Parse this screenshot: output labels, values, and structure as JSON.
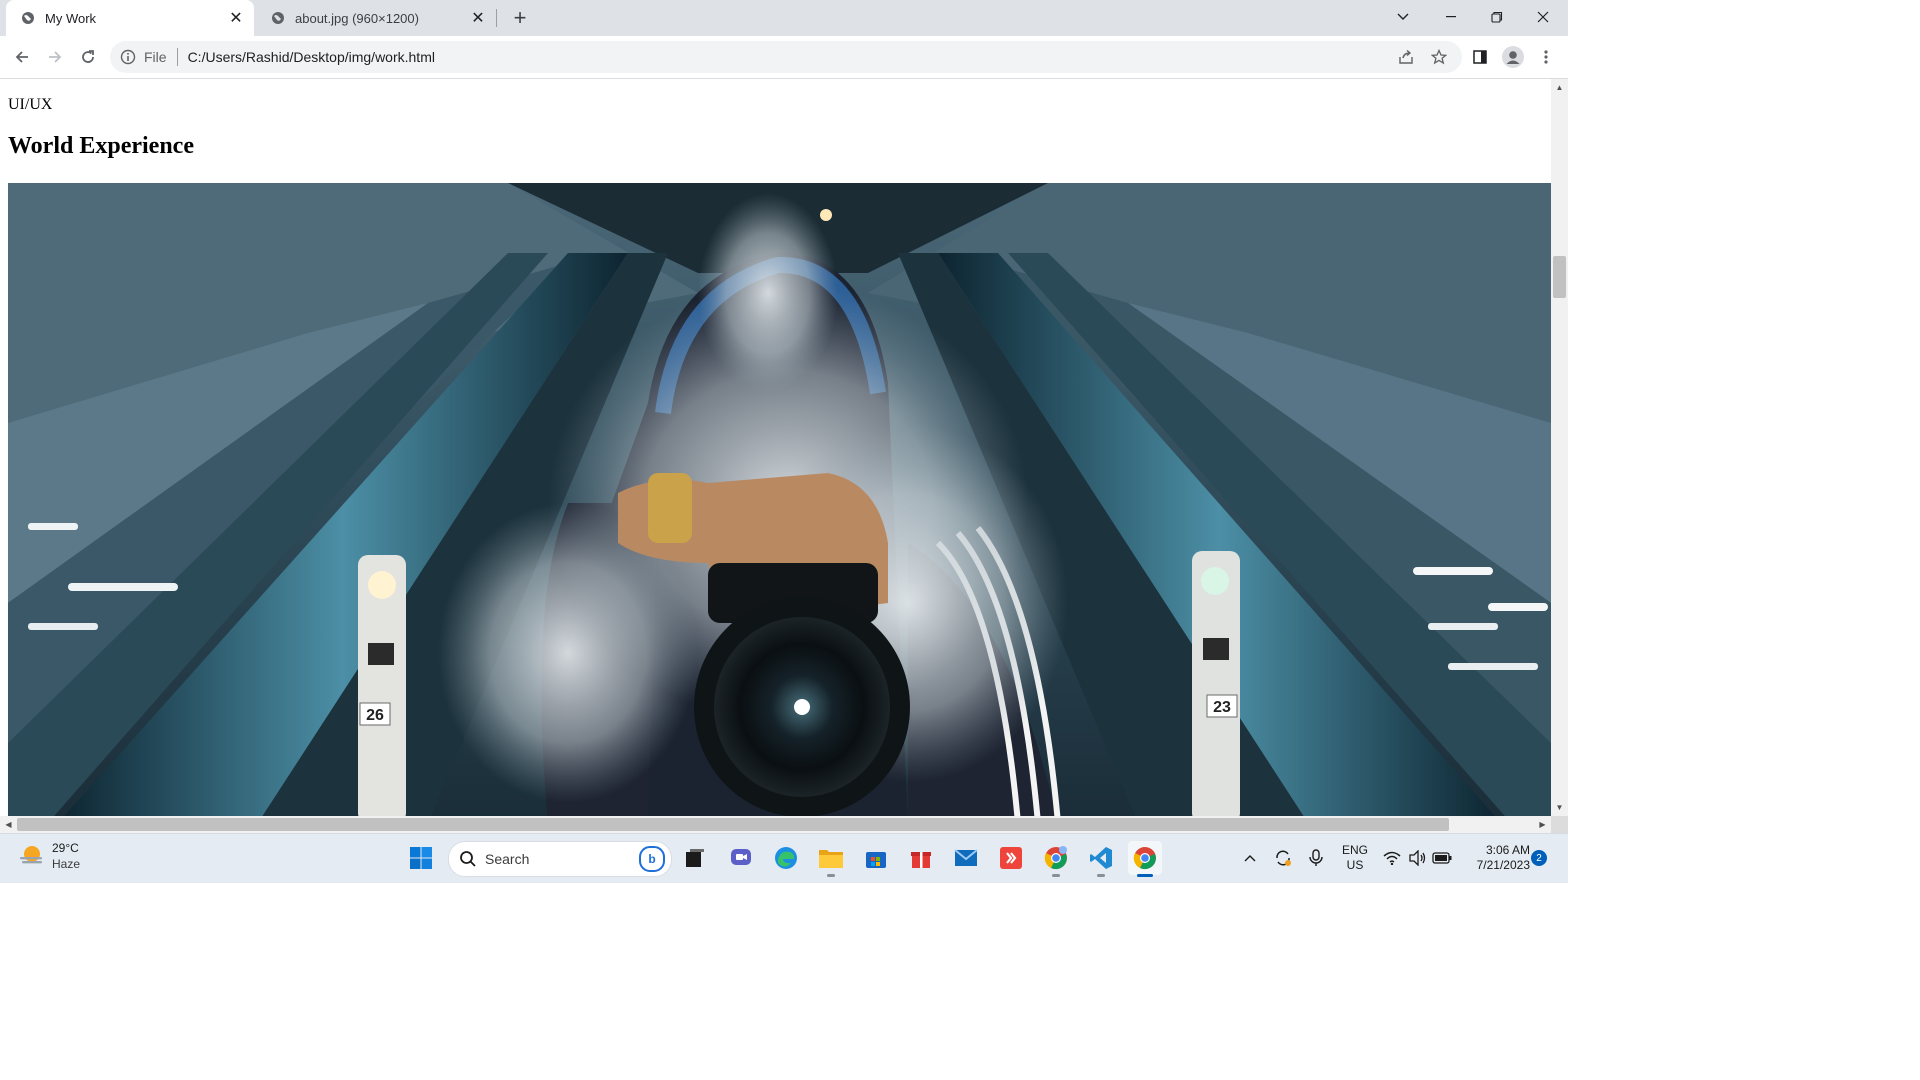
{
  "browser": {
    "tabs": [
      {
        "title": "My Work",
        "active": true
      },
      {
        "title": "about.jpg (960×1200)",
        "active": false
      }
    ],
    "address": {
      "scheme_label": "File",
      "url": "C:/Users/Rashid/Desktop/img/work.html"
    }
  },
  "page": {
    "subtitle": "UI/UX",
    "heading": "World Experience",
    "image_description_name": "photographer-with-camera-on-escalator",
    "escalator_numbers": {
      "left": "26",
      "right": "23"
    },
    "vertical_scroll_fraction": 0.27
  },
  "taskbar": {
    "weather": {
      "temp": "29°C",
      "condition": "Haze"
    },
    "search_placeholder": "Search",
    "language": {
      "line1": "ENG",
      "line2": "US"
    },
    "clock": {
      "time": "3:06 AM",
      "date": "7/21/2023"
    },
    "notification_count": "2"
  },
  "colors": {
    "tabstrip": "#dee1e6",
    "omnibox": "#f1f3f4",
    "taskbar": "#e4ebf3",
    "accent": "#005fb8"
  }
}
